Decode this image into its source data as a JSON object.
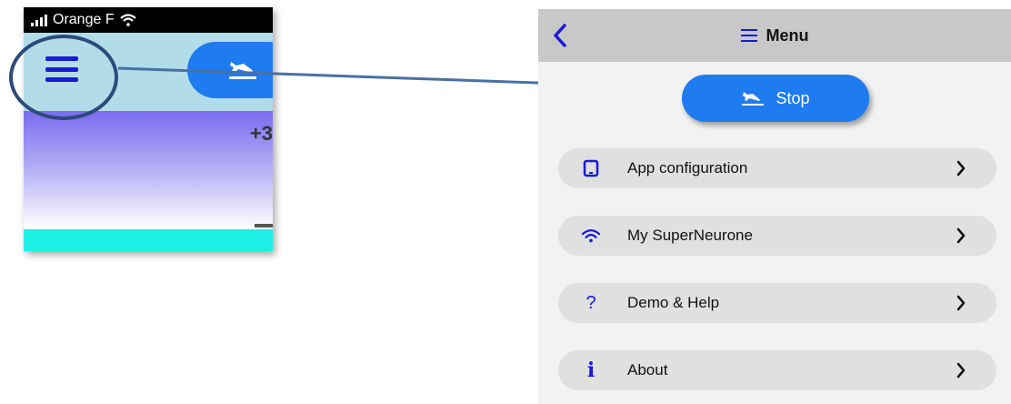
{
  "phone": {
    "carrier": "Orange F",
    "partial_number": "+3"
  },
  "menu": {
    "title": "Menu",
    "stop_label": "Stop",
    "items": [
      {
        "label": "App configuration",
        "icon": "tablet-icon"
      },
      {
        "label": "My SuperNeurone",
        "icon": "wifi-icon"
      },
      {
        "label": "Demo & Help",
        "icon": "question-icon"
      },
      {
        "label": "About",
        "icon": "info-icon"
      }
    ]
  },
  "colors": {
    "accent_blue": "#1e7bf0",
    "icon_blue": "#1a1ad6",
    "nav_gray": "#c8c8c8",
    "row_gray": "#e0e0e0",
    "panel_bg": "#f2f2f2",
    "annotation_navy": "#2d4a7c",
    "arrow_blue": "#4a6fa5"
  }
}
